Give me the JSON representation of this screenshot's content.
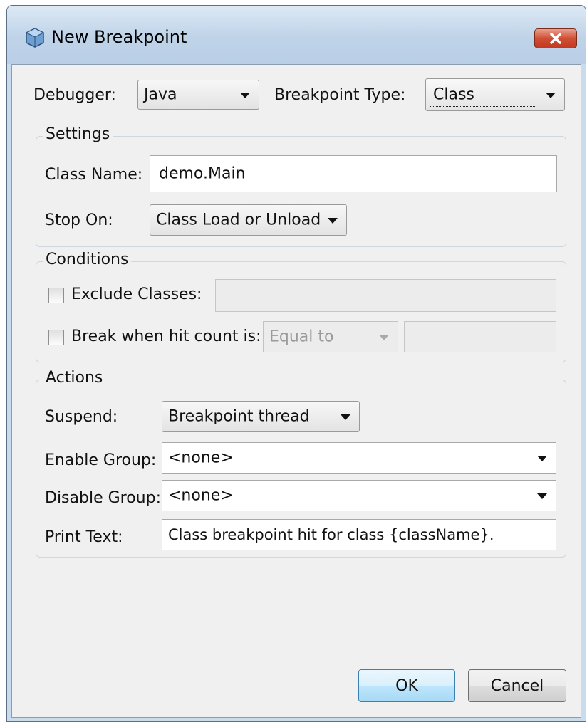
{
  "window": {
    "title": "New Breakpoint"
  },
  "top": {
    "debugger_label": "Debugger:",
    "debugger_value": "Java",
    "type_label": "Breakpoint Type:",
    "type_value": "Class"
  },
  "settings": {
    "title": "Settings",
    "class_name_label": "Class Name:",
    "class_name_value": "demo.Main",
    "stop_on_label": "Stop On:",
    "stop_on_value": "Class Load or Unload"
  },
  "conditions": {
    "title": "Conditions",
    "exclude_label": "Exclude Classes:",
    "exclude_value": "",
    "exclude_checked": false,
    "hitcount_label": "Break when hit count is:",
    "hitcount_op": "Equal to",
    "hitcount_value": "",
    "hitcount_checked": false
  },
  "actions": {
    "title": "Actions",
    "suspend_label": "Suspend:",
    "suspend_value": "Breakpoint thread",
    "enable_group_label": "Enable Group:",
    "enable_group_value": "<none>",
    "disable_group_label": "Disable Group:",
    "disable_group_value": "<none>",
    "print_text_label": "Print Text:",
    "print_text_value": "Class breakpoint hit for class {className}."
  },
  "buttons": {
    "ok": "OK",
    "cancel": "Cancel"
  },
  "colors": {
    "frame": "#c9dbec",
    "close_button": "#cf4f35",
    "dialog_bg": "#f0f0f0",
    "default_button": "#bee6fd"
  }
}
